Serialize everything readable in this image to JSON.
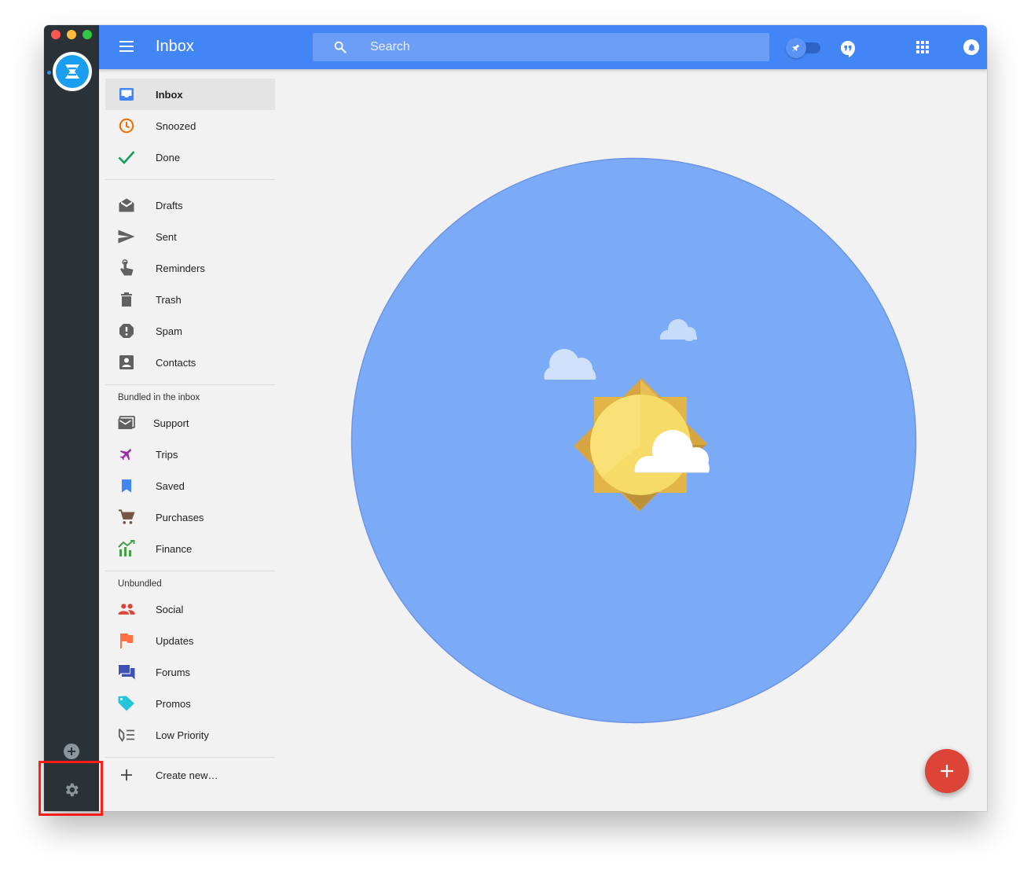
{
  "window": {
    "traffic_lights": [
      "close",
      "minimize",
      "maximize"
    ]
  },
  "rail": {
    "account_icon": "mail-app-logo-icon",
    "add_account_icon": "plus-circle-icon",
    "settings_icon": "gear-icon"
  },
  "header": {
    "menu_icon": "hamburger-menu-icon",
    "title": "Inbox",
    "search": {
      "placeholder": "Search",
      "value": ""
    },
    "pin_toggle": {
      "icon": "pin-icon",
      "on": false
    },
    "hangouts_icon": "hangouts-icon",
    "apps_icon": "apps-grid-icon",
    "notifications_icon": "bell-icon"
  },
  "nav": {
    "primary": [
      {
        "label": "Inbox",
        "icon": "inbox-icon",
        "color": "#4285f4",
        "active": true
      },
      {
        "label": "Snoozed",
        "icon": "clock-icon",
        "color": "#ef6c00"
      },
      {
        "label": "Done",
        "icon": "check-icon",
        "color": "#0f9d58"
      }
    ],
    "folders": [
      {
        "label": "Drafts",
        "icon": "drafts-icon",
        "color": "#616161"
      },
      {
        "label": "Sent",
        "icon": "send-icon",
        "color": "#616161"
      },
      {
        "label": "Reminders",
        "icon": "reminder-hand-icon",
        "color": "#616161"
      },
      {
        "label": "Trash",
        "icon": "trash-icon",
        "color": "#616161"
      },
      {
        "label": "Spam",
        "icon": "spam-icon",
        "color": "#616161"
      },
      {
        "label": "Contacts",
        "icon": "contacts-icon",
        "color": "#616161"
      }
    ],
    "bundled_heading": "Bundled in the inbox",
    "bundled": [
      {
        "label": "Support",
        "icon": "support-mail-icon",
        "color": "#616161"
      },
      {
        "label": "Trips",
        "icon": "plane-icon",
        "color": "#9c27b0"
      },
      {
        "label": "Saved",
        "icon": "bookmark-icon",
        "color": "#4285f4"
      },
      {
        "label": "Purchases",
        "icon": "cart-icon",
        "color": "#795548"
      },
      {
        "label": "Finance",
        "icon": "finance-chart-icon",
        "color": "#43a047"
      }
    ],
    "unbundled_heading": "Unbundled",
    "unbundled": [
      {
        "label": "Social",
        "icon": "people-icon",
        "color": "#db4437"
      },
      {
        "label": "Updates",
        "icon": "flag-icon",
        "color": "#ff7043"
      },
      {
        "label": "Forums",
        "icon": "forum-icon",
        "color": "#3f51b5"
      },
      {
        "label": "Promos",
        "icon": "tag-icon",
        "color": "#26c6da"
      },
      {
        "label": "Low Priority",
        "icon": "low-priority-icon",
        "color": "#616161"
      }
    ],
    "create_new": {
      "label": "Create new…",
      "icon": "plus-icon"
    }
  },
  "main": {
    "illustration": "sunny-inbox-zero-illustration"
  },
  "fab": {
    "icon": "compose-plus-icon",
    "color": "#db4437"
  }
}
